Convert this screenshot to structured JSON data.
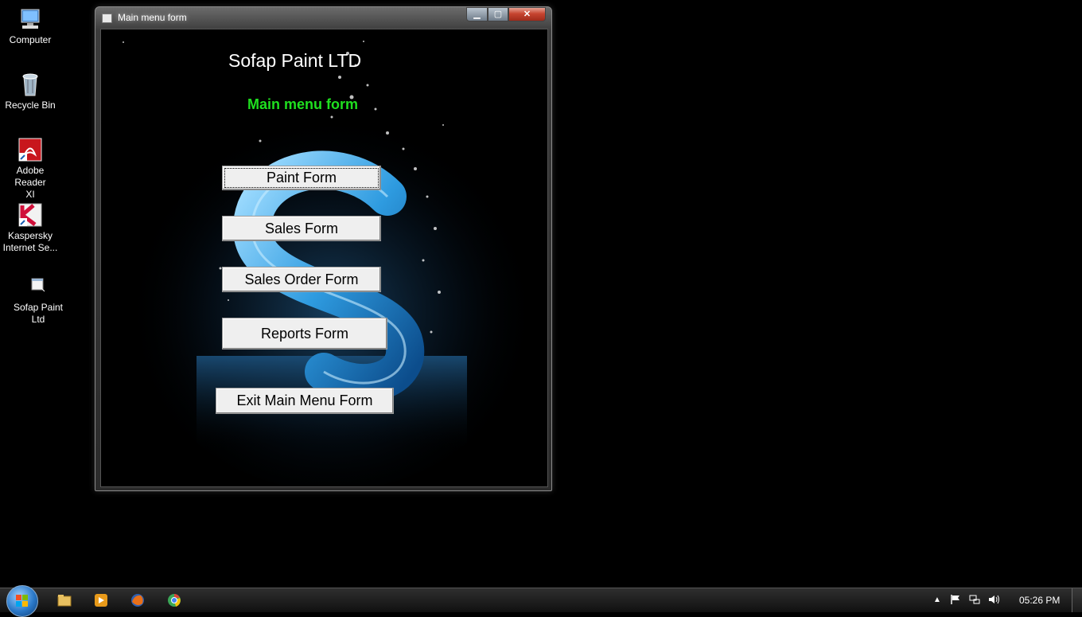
{
  "desktop": {
    "icons": [
      {
        "label": "Computer",
        "icon": "computer-icon"
      },
      {
        "label": "Recycle Bin",
        "icon": "recycle-bin-icon"
      },
      {
        "label": "Adobe Reader XI",
        "icon": "adobe-reader-icon"
      },
      {
        "label": "Kaspersky Internet Se...",
        "icon": "kaspersky-icon"
      },
      {
        "label": "Sofap Paint Ltd",
        "icon": "app-shortcut-icon"
      }
    ]
  },
  "window": {
    "title": "Main menu form",
    "controls": {
      "minimize": "▁",
      "maximize": "▢",
      "close": "✕"
    }
  },
  "form": {
    "title": "Sofap Paint LTD",
    "subtitle": "Main menu form",
    "buttons": {
      "paint": "Paint Form",
      "sales": "Sales Form",
      "sales_order": "Sales Order Form",
      "reports": "Reports Form",
      "exit": "Exit Main Menu Form"
    }
  },
  "taskbar": {
    "pinned": [
      "windows-explorer-icon",
      "media-player-icon",
      "firefox-icon",
      "chrome-icon"
    ],
    "tray": [
      "show-hidden-icons-icon",
      "action-center-flag-icon",
      "network-icon",
      "volume-icon"
    ],
    "clock": "05:26 PM"
  },
  "colors": {
    "subtitle_green": "#1fe01f",
    "close_red": "#c74530",
    "button_face": "#efefef"
  }
}
